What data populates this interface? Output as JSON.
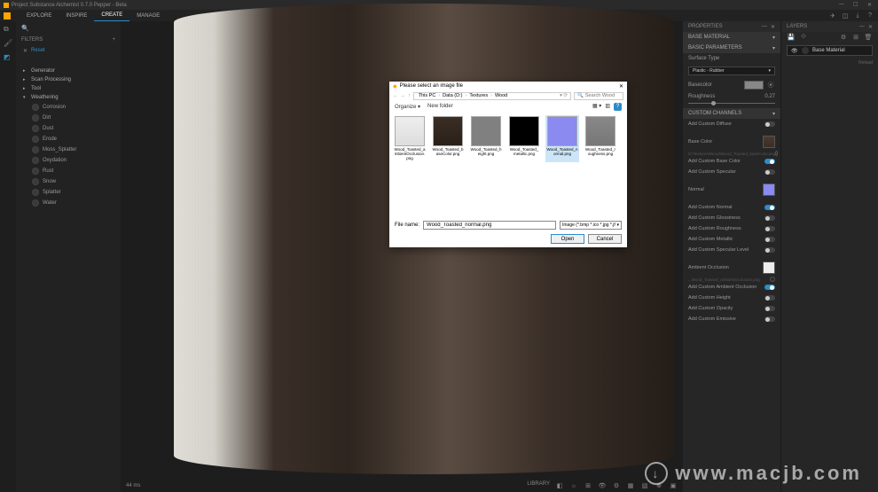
{
  "app": {
    "title": "Project Substance Alchemist 0.7.0 Pepper - Beta"
  },
  "menu": {
    "items": [
      "EXPLORE",
      "INSPIRE",
      "CREATE",
      "MANAGE"
    ],
    "active": 2
  },
  "filters": {
    "header": "FILTERS",
    "reset_label": "Reset"
  },
  "tree": {
    "groups": [
      {
        "label": "Generator",
        "open": false
      },
      {
        "label": "Scan Processing",
        "open": false
      },
      {
        "label": "Tool",
        "open": false
      },
      {
        "label": "Weathering",
        "open": true,
        "items": [
          "Corrosion",
          "Dirt",
          "Dust",
          "Erode",
          "Moss_Splatter",
          "Oxydation",
          "Rust",
          "Snow",
          "Splatter",
          "Water"
        ]
      }
    ]
  },
  "viewport": {
    "footer_left": "44 ms",
    "footer_right": "LIBRARY"
  },
  "properties": {
    "title": "PROPERTIES",
    "sections": {
      "base_material": "BASE MATERIAL",
      "basic_parameters": "BASIC PARAMETERS",
      "custom_channels": "CUSTOM CHANNELS"
    },
    "surface_type": {
      "label": "Surface Type",
      "value": "Plastic - Rubber"
    },
    "basecolor_label": "Basecolor",
    "roughness": {
      "label": "Roughness",
      "value": "0.27",
      "pct": 27
    },
    "toggles": {
      "add_custom_diffuse": "Add Custom Diffuse",
      "base_color": "Base Color",
      "add_custom_base_color": "Add Custom Base Color",
      "add_custom_specular": "Add Custom Specular",
      "normal": "Normal",
      "add_custom_normal": "Add Custom Normal",
      "add_custom_glossiness": "Add Custom Glossiness",
      "add_custom_roughness": "Add Custom Roughness",
      "add_custom_metallic": "Add Custom Metallic",
      "add_custom_specular_level": "Add Custom Specular Level",
      "ambient_occlusion": "Ambient Occlusion",
      "add_custom_ao": "Add Custom Ambient Occlusion",
      "add_custom_height": "Add Custom Height",
      "add_custom_opacity": "Add Custom Opacity",
      "add_custom_emissive": "Add Custom Emissive"
    }
  },
  "layers": {
    "title": "LAYERS",
    "item": "Base Material",
    "reload": "Reload"
  },
  "dialog": {
    "title": "Please select an image file",
    "breadcrumb": [
      "This PC",
      "Data (D:)",
      "Textures",
      "Wood"
    ],
    "search_placeholder": "Search Wood",
    "organize": "Organize",
    "newfolder": "New folder",
    "files": [
      {
        "name": "Wood_Toasted_ambientOcclusion.png",
        "thumb": "linear-gradient(#eee,#ddd)"
      },
      {
        "name": "Wood_Toasted_baseColor.png",
        "thumb": "linear-gradient(#3a2e24,#2a2018)"
      },
      {
        "name": "Wood_Toasted_height.png",
        "thumb": "#808080"
      },
      {
        "name": "Wood_Toasted_metallic.png",
        "thumb": "#000000"
      },
      {
        "name": "Wood_Toasted_normal.png",
        "thumb": "#8a8af0",
        "selected": true
      },
      {
        "name": "Wood_Toasted_roughness.png",
        "thumb": "linear-gradient(#888,#777)"
      }
    ],
    "filename_label": "File name:",
    "filename_value": "Wood_Toasted_normal.png",
    "filetype": "Image (*.bmp *.ico *.jpg *.jf",
    "open": "Open",
    "cancel": "Cancel"
  },
  "watermark": "www.macjb.com"
}
